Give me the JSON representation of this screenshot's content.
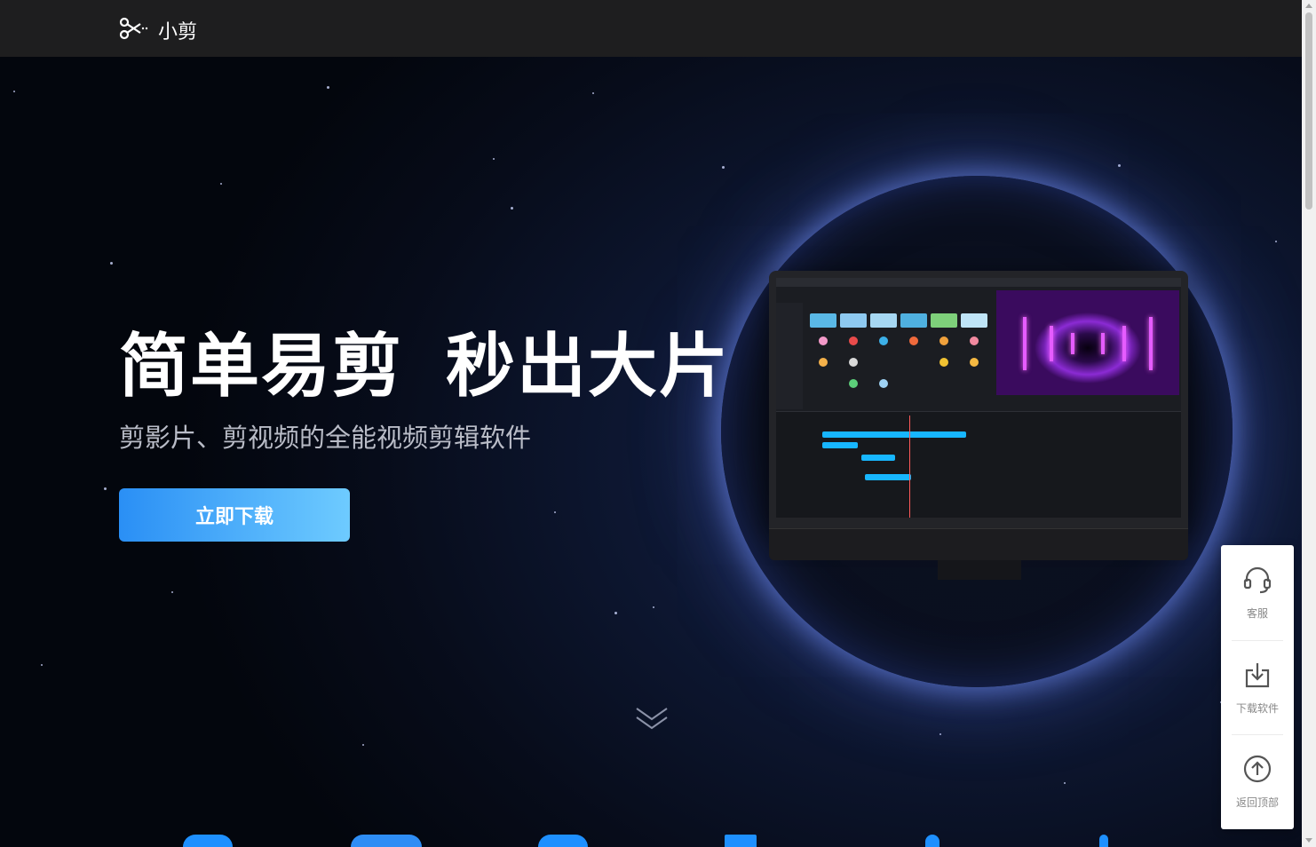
{
  "header": {
    "brand_name": "小剪",
    "logo_icon": "scissors-icon"
  },
  "hero": {
    "headline_part1": "简单易剪",
    "headline_part2": "秒出大片",
    "subheadline": "剪影片、剪视频的全能视频剪辑软件",
    "download_label": "立即下载",
    "scroll_hint_icon": "chevron-down-icon"
  },
  "side_panel": {
    "items": [
      {
        "label": "客服",
        "icon": "headset-icon"
      },
      {
        "label": "下载软件",
        "icon": "download-icon"
      },
      {
        "label": "返回顶部",
        "icon": "arrow-up-circle-icon"
      }
    ]
  },
  "colors": {
    "header_bg": "#1e1e1f",
    "button_gradient_start": "#2a8ff5",
    "button_gradient_end": "#6ecbff",
    "accent": "#17b6ff"
  }
}
